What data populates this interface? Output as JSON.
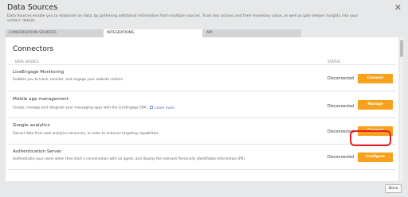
{
  "dialog": {
    "title": "Data Sources",
    "description": "Data Sources enable you to elaborate on data, by gathering additional information from multiple sources. Track key actions and their monetary value, as well as gain deeper insights into your visitors' details."
  },
  "tabs": [
    {
      "label": "CONVERSATION SOURCES"
    },
    {
      "label": "INTEGRATIONS"
    },
    {
      "label": "API"
    }
  ],
  "connectors": {
    "heading": "Connectors",
    "col_source": "DATA SOURCE",
    "col_status": "STATUS",
    "rows": [
      {
        "name": "LiveEngage Monitoring",
        "description": "Enables you to track, monitor, and engage your website visitors.",
        "status": "Disconnected",
        "action": "Connect"
      },
      {
        "name": "Mobile app management",
        "description": "Create, manage and integrate your messaging apps with the LiveEngage SDK.",
        "link": "Learn more",
        "status": "Disconnected",
        "action": "Manage"
      },
      {
        "name": "Google analytics",
        "description": "Extract data from web analytics resources, in order to enhance targeting capabilities.",
        "status": "Disconnected",
        "action": "Connect"
      },
      {
        "name": "Authentication Server",
        "description": "Authenticate your users when they start a conversation with an agent, and display the relevant Personally Identifiable Information (PII).",
        "status": "Disconnected",
        "action": "Configure"
      }
    ]
  },
  "footer": {
    "done_label": "Done"
  },
  "colors": {
    "accent": "#f7a11c",
    "highlight": "#e41c23"
  }
}
